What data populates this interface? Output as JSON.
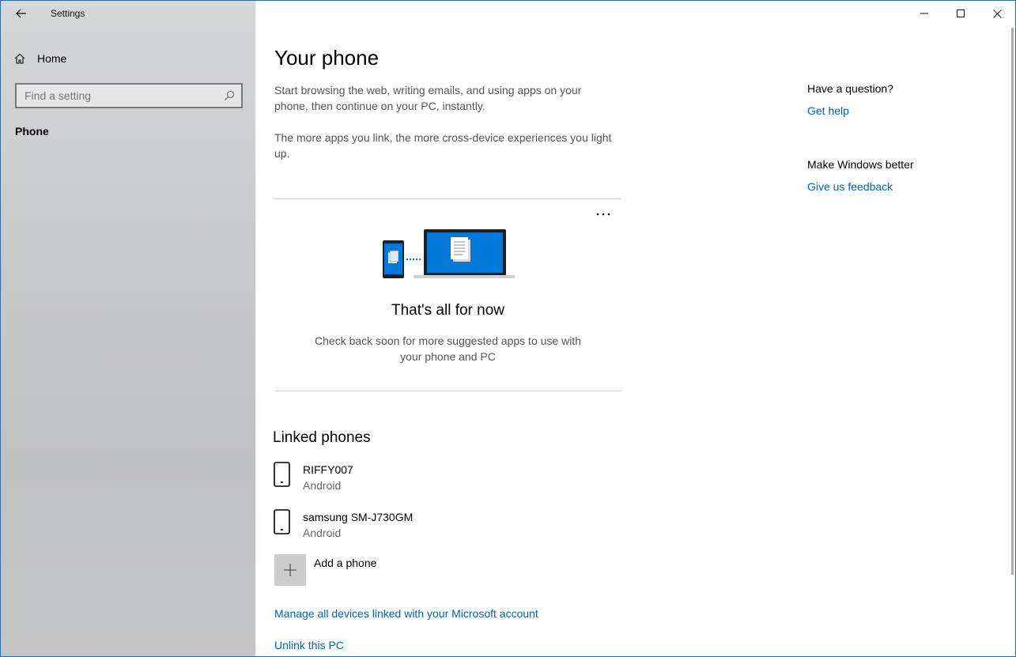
{
  "window": {
    "title": "Settings",
    "accent_color": "#0078d7",
    "controls": [
      "minimize-icon",
      "maximize-icon",
      "close-icon"
    ]
  },
  "sidebar": {
    "home_label": "Home",
    "search": {
      "placeholder": "Find a setting",
      "value": ""
    },
    "items": [
      {
        "label": "Phone",
        "selected": true
      }
    ]
  },
  "main": {
    "title": "Your phone",
    "intro_1": "Start browsing the web, writing emails, and using apps on your phone, then continue on your PC, instantly.",
    "intro_2": "The more apps you link, the more cross-device experiences you light up.",
    "empty_state": {
      "title": "That's all for now",
      "description": "Check back soon for more suggested apps to use with your phone and PC"
    },
    "linked_phones": {
      "title": "Linked phones",
      "phones": [
        {
          "name": "RIFFY007",
          "type": "Android"
        },
        {
          "name": "samsung SM-J730GM",
          "type": "Android"
        }
      ],
      "add_label": "Add a phone"
    },
    "manage_link": "Manage all devices linked with your Microsoft account",
    "unlink_link": "Unlink this PC"
  },
  "aside": {
    "question_heading": "Have a question?",
    "help_link": "Get help",
    "feedback_heading": "Make Windows better",
    "feedback_link": "Give us feedback"
  },
  "colors": {
    "link": "#0063b1",
    "sidebar": "#c9cacc"
  }
}
